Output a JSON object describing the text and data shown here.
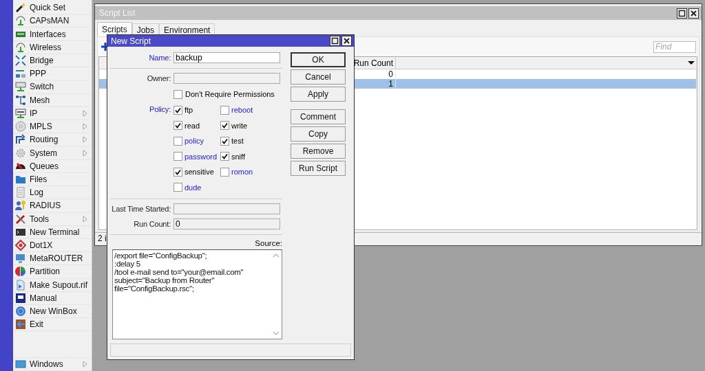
{
  "menu": {
    "items": [
      {
        "label": "Quick Set",
        "submenu": false
      },
      {
        "label": "CAPsMAN",
        "submenu": false
      },
      {
        "label": "Interfaces",
        "submenu": false
      },
      {
        "label": "Wireless",
        "submenu": false
      },
      {
        "label": "Bridge",
        "submenu": false
      },
      {
        "label": "PPP",
        "submenu": false
      },
      {
        "label": "Switch",
        "submenu": false
      },
      {
        "label": "Mesh",
        "submenu": false
      },
      {
        "label": "IP",
        "submenu": true
      },
      {
        "label": "MPLS",
        "submenu": true
      },
      {
        "label": "Routing",
        "submenu": true
      },
      {
        "label": "System",
        "submenu": true
      },
      {
        "label": "Queues",
        "submenu": false
      },
      {
        "label": "Files",
        "submenu": false
      },
      {
        "label": "Log",
        "submenu": false
      },
      {
        "label": "RADIUS",
        "submenu": false
      },
      {
        "label": "Tools",
        "submenu": true
      },
      {
        "label": "New Terminal",
        "submenu": false
      },
      {
        "label": "Dot1X",
        "submenu": false
      },
      {
        "label": "MetaROUTER",
        "submenu": false
      },
      {
        "label": "Partition",
        "submenu": false
      },
      {
        "label": "Make Supout.rif",
        "submenu": false
      },
      {
        "label": "Manual",
        "submenu": false
      },
      {
        "label": "New WinBox",
        "submenu": false
      },
      {
        "label": "Exit",
        "submenu": false
      }
    ],
    "bottom_items": [
      {
        "label": "Windows",
        "submenu": true
      }
    ]
  },
  "script_list": {
    "title": "Script List",
    "tabs": [
      {
        "label": "Scripts",
        "selected": true
      },
      {
        "label": "Jobs",
        "selected": false
      },
      {
        "label": "Environment",
        "selected": false
      }
    ],
    "find": {
      "placeholder": "Find"
    },
    "columns": [
      "Run Count"
    ],
    "rows": [
      {
        "run_count": "0",
        "selected": false
      },
      {
        "run_count": "1",
        "selected": true
      }
    ],
    "status": "2 i"
  },
  "new_script": {
    "title": "New Script",
    "name": {
      "label": "Name:",
      "value": "backup"
    },
    "owner": {
      "label": "Owner:"
    },
    "dont_require_permissions": {
      "label": "Don't Require Permissions",
      "checked": false
    },
    "policy": {
      "label": "Policy:",
      "options": [
        {
          "label": "ftp",
          "checked": true
        },
        {
          "label": "reboot",
          "checked": false
        },
        {
          "label": "read",
          "checked": true
        },
        {
          "label": "write",
          "checked": true
        },
        {
          "label": "policy",
          "checked": false
        },
        {
          "label": "test",
          "checked": true
        },
        {
          "label": "password",
          "checked": false
        },
        {
          "label": "sniff",
          "checked": true
        },
        {
          "label": "sensitive",
          "checked": true
        },
        {
          "label": "romon",
          "checked": false
        },
        {
          "label": "dude",
          "checked": false
        }
      ]
    },
    "last_time_started": {
      "label": "Last Time Started:"
    },
    "run_count": {
      "label": "Run Count:",
      "value": "0"
    },
    "source": {
      "label": "Source:",
      "lines": [
        "/export file=\"ConfigBackup\";",
        ":delay 5",
        "/tool e-mail send to=\"your@email.com\"",
        "subject=\"Backup from Router\"",
        "file=\"ConfigBackup.rsc\";"
      ]
    },
    "buttons": [
      "OK",
      "Cancel",
      "Apply",
      "Comment",
      "Copy",
      "Remove",
      "Run Script"
    ]
  }
}
